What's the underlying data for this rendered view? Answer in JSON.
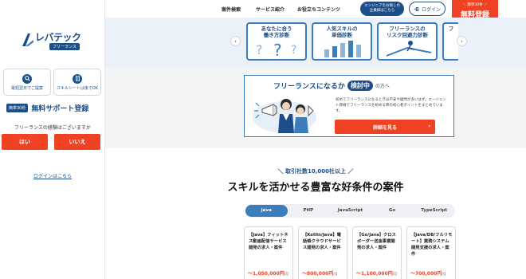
{
  "sidebar": {
    "logo_text": "レバテック",
    "logo_sub": "フリーランス",
    "btn_consult": "最短翌日でご提案",
    "btn_skill": "スキルシートは後でOK",
    "support_badge": "簡単30秒",
    "support_title": "無料サポート登録",
    "question": "フリーランスの経験はございますか",
    "yes": "はい",
    "no": "いいえ",
    "login": "ログインはこちら"
  },
  "nav": {
    "items": [
      "案件検索",
      "サービス紹介",
      "お役立ちコンテンツ"
    ],
    "consult_line1": "エンジニアをお探しの",
    "consult_line2": "企業様はこちら",
    "login": "ログイン",
    "register_small": "＼ 簡単30秒 ／",
    "register": "無料登録"
  },
  "carousel": {
    "cards": [
      {
        "line1": "あなたに合う",
        "line2": "働き方診断"
      },
      {
        "line1": "人気スキルの",
        "line2": "単価診断"
      },
      {
        "line1": "フリーランスの",
        "line2": "リスク回避力診断"
      },
      {
        "line1": "フ",
        "line2": ""
      }
    ]
  },
  "banner": {
    "title": "フリーランスになるか",
    "highlight": "検討中",
    "suffix": "の方へ",
    "desc": "初めてフリーランスになるときは不安や疑問が多いはず。エージェント目線でフリーランスを始める際の初心者ポイントをまとめています。",
    "cta": "詳細を見る"
  },
  "main": {
    "tagline": "＼ 取引社数10,000社以上 ／",
    "headline": "スキルを活かせる豊富な好条件の案件",
    "tabs": [
      "Java",
      "PHP",
      "JavaScript",
      "Go",
      "TypeScript"
    ],
    "jobs": [
      {
        "title": "【Java】フィットネス動画配信サービス開発の求人・案件",
        "salary": "～1,050,000円",
        "unit": "/月"
      },
      {
        "title": "【Kotlin/Java】電話帳クラウドサービス開発の求人・案件",
        "salary": "～800,000円",
        "unit": "/月"
      },
      {
        "title": "【Go/Java】クロスボーダー送金事業開発の求人・案件",
        "salary": "～1,100,000円",
        "unit": "/月"
      },
      {
        "title": "【Java/DB/フルリモート】業務システム開発支援の求人・案件",
        "salary": "～700,000円",
        "unit": "/月"
      }
    ]
  },
  "colors": {
    "brand": "#1d4e89",
    "accent": "#ef4123",
    "card_border": "#3c7dbb"
  }
}
